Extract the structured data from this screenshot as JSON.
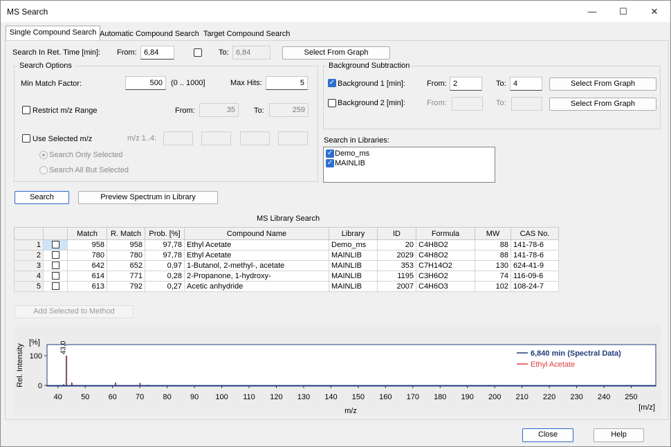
{
  "window": {
    "title": "MS Search",
    "minimize": "—",
    "maximize": "☐",
    "close": "✕"
  },
  "tabs": [
    "Single Compound Search",
    "Automatic Compound Search",
    "Target Compound Search"
  ],
  "ret_time": {
    "label": "Search In Ret. Time [min]:",
    "from_label": "From:",
    "from_value": "6,84",
    "to_label": "To:",
    "to_value": "6,84",
    "select_graph": "Select From Graph"
  },
  "search_options": {
    "title": "Search Options",
    "min_match_label": "Min Match Factor:",
    "min_match_value": "500",
    "min_match_range": "(0 .. 1000]",
    "max_hits_label": "Max Hits:",
    "max_hits_value": "5",
    "restrict_label": "Restrict m/z Range",
    "from_label": "From:",
    "from_value": "35",
    "to_label": "To:",
    "to_value": "259",
    "use_selected_label": "Use Selected m/z",
    "mz_label": "m/z 1..4:",
    "radio_only": "Search Only Selected",
    "radio_all": "Search All But Selected"
  },
  "background": {
    "title": "Background Subtraction",
    "bg1_label": "Background 1 [min]:",
    "bg1_from_label": "From:",
    "bg1_from": "2",
    "bg1_to_label": "To:",
    "bg1_to": "4",
    "bg2_label": "Background 2 [min]:",
    "bg2_from_label": "From:",
    "bg2_to_label": "To:",
    "select_graph": "Select From Graph"
  },
  "libraries": {
    "label": "Search in Libraries:",
    "items": [
      "Demo_ms",
      "MAINLIB"
    ]
  },
  "buttons": {
    "search": "Search",
    "preview": "Preview Spectrum in Library",
    "add_selected": "Add Selected to Method",
    "close": "Close",
    "help": "Help"
  },
  "results": {
    "title": "MS Library Search",
    "headers": [
      "",
      "",
      "Match",
      "R. Match",
      "Prob. [%]",
      "Compound Name",
      "Library",
      "ID",
      "Formula",
      "MW",
      "CAS No."
    ],
    "rows": [
      [
        "1",
        "958",
        "958",
        "97,78",
        "Ethyl Acetate",
        "Demo_ms",
        "20",
        "C4H8O2",
        "88",
        "141-78-6"
      ],
      [
        "2",
        "780",
        "780",
        "97,78",
        "Ethyl Acetate",
        "MAINLIB",
        "2029",
        "C4H8O2",
        "88",
        "141-78-6"
      ],
      [
        "3",
        "642",
        "652",
        "0,97",
        "1-Butanol, 2-methyl-, acetate",
        "MAINLIB",
        "353",
        "C7H14O2",
        "130",
        "624-41-9"
      ],
      [
        "4",
        "614",
        "771",
        "0,28",
        "2-Propanone, 1-hydroxy-",
        "MAINLIB",
        "1195",
        "C3H6O2",
        "74",
        "116-09-6"
      ],
      [
        "5",
        "613",
        "792",
        "0,27",
        "Acetic anhydride",
        "MAINLIB",
        "2007",
        "C4H6O3",
        "102",
        "108-24-7"
      ]
    ]
  },
  "chart_data": {
    "type": "bar",
    "ylabel": "Rel. Intensity",
    "yunit": "[%]",
    "xlabel": "m/z",
    "xunit": "[m/z]",
    "xlim": [
      36,
      259
    ],
    "ylim": [
      0,
      100
    ],
    "xticks": [
      40,
      50,
      60,
      70,
      80,
      90,
      100,
      110,
      120,
      130,
      140,
      150,
      160,
      170,
      180,
      190,
      200,
      210,
      220,
      230,
      240,
      250
    ],
    "yticks": [
      0,
      100
    ],
    "peak_label": "43,0",
    "series": [
      {
        "name": "6,840 min (Spectral Data)",
        "color": "#1f3a7a",
        "x": [
          42,
          43,
          45,
          61,
          70,
          73,
          88
        ],
        "y": [
          4,
          100,
          10,
          10,
          9,
          2,
          1
        ]
      },
      {
        "name": "Ethyl Acetate",
        "color": "#e04040",
        "x": [
          42,
          43,
          45,
          61,
          70,
          73,
          88
        ],
        "y": [
          4,
          100,
          9,
          10,
          8,
          2,
          1
        ]
      }
    ]
  }
}
